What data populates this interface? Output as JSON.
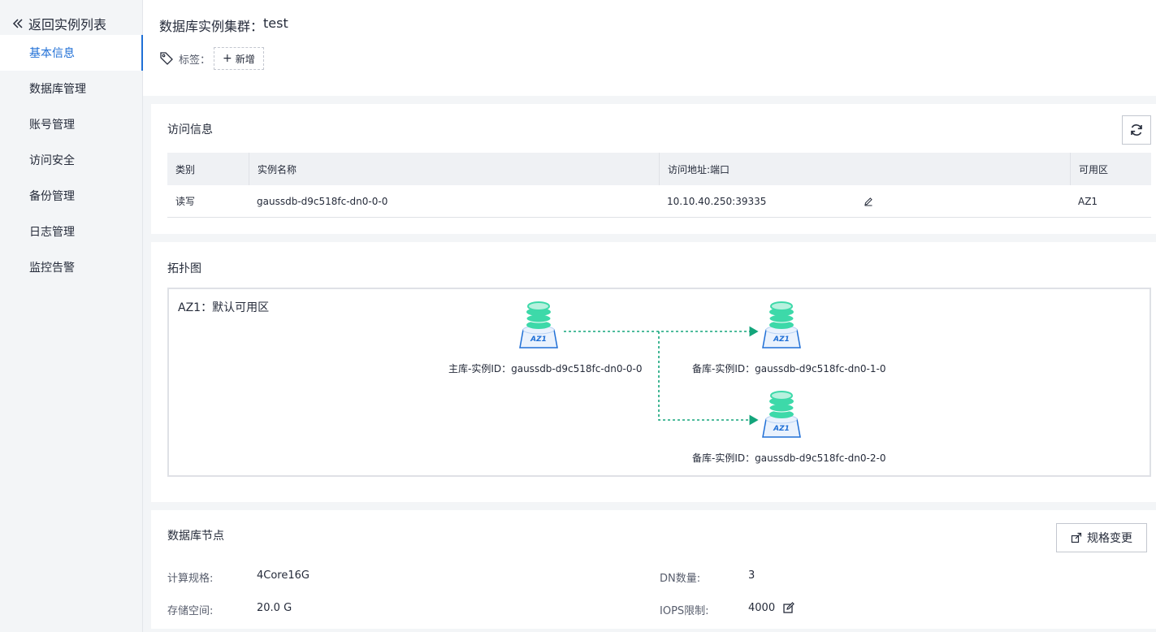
{
  "sidebar": {
    "back_label": "返回实例列表",
    "items": [
      {
        "label": "基本信息",
        "active": true
      },
      {
        "label": "数据库管理",
        "active": false
      },
      {
        "label": "账号管理",
        "active": false
      },
      {
        "label": "访问安全",
        "active": false
      },
      {
        "label": "备份管理",
        "active": false
      },
      {
        "label": "日志管理",
        "active": false
      },
      {
        "label": "监控告警",
        "active": false
      }
    ]
  },
  "header": {
    "title_prefix": "数据库实例集群：",
    "title_name": "test",
    "tag_label": "标签：",
    "add_tag_label": "新增"
  },
  "access": {
    "title": "访问信息",
    "columns": [
      "类别",
      "实例名称",
      "访问地址:端口",
      "可用区"
    ],
    "rows": [
      {
        "type": "读写",
        "instance": "gaussdb-d9c518fc-dn0-0-0",
        "address": "10.10.40.250:39335",
        "az": "AZ1"
      }
    ]
  },
  "topology": {
    "title": "拓扑图",
    "az_label": "AZ1：默认可用区",
    "node_badge": "AZ1",
    "primary": "主库-实例ID：gaussdb-d9c518fc-dn0-0-0",
    "standby1": "备库-实例ID：gaussdb-d9c518fc-dn0-1-0",
    "standby2": "备库-实例ID：gaussdb-d9c518fc-dn0-2-0"
  },
  "nodes": {
    "title": "数据库节点",
    "spec_change_label": "规格变更",
    "compute_key": "计算规格:",
    "compute_value": "4Core16G",
    "storage_key": "存储空间:",
    "storage_value": "20.0 G",
    "dn_key": "DN数量:",
    "dn_value": "3",
    "iops_key": "IOPS限制:",
    "iops_value": "4000"
  },
  "colors": {
    "accent": "#1f6fd6",
    "link": "#13a57b",
    "db_top": "#3dd9a9",
    "db_base": "#1f6fd6"
  }
}
